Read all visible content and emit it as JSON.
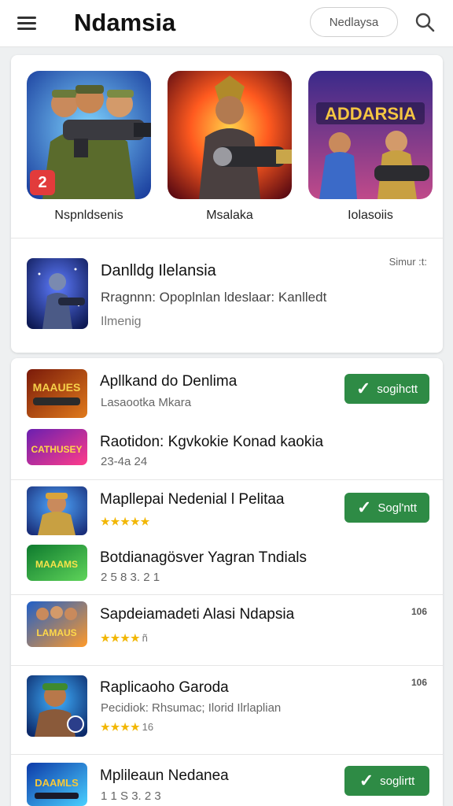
{
  "app": {
    "title": "Ndamsia",
    "search_label": "Nedlaysa"
  },
  "icons": {
    "menu": "hamburger-menu-icon",
    "search": "magnifier-icon",
    "install_check": "checkmark-icon"
  },
  "colors": {
    "accent": "#2e8b45",
    "star": "#f2b705",
    "background": "#eef0f1"
  },
  "featured": {
    "tiles": [
      {
        "label": "Nspnldsenis",
        "badge": "2"
      },
      {
        "label": "Msalaka"
      },
      {
        "label": "Iolasoiis",
        "art_text": "ADDARSIA"
      }
    ],
    "spotlight": {
      "title": "Danlldg Ilelansia",
      "subtitle": "Rragnnn: Opoplnlan ldeslaar: Kanlledt",
      "tag": "Ilmenig",
      "size": "Simur :t:"
    }
  },
  "list": [
    {
      "title": "Apllkand do Denlima",
      "subtitle": "Lasaootka Mkara",
      "art_text": "MAAUES",
      "action": {
        "check": "✓",
        "label": "sogihctt"
      }
    },
    {
      "title": "Raotidon: Kgvkokie Konad kaokia",
      "subtitle": "23-4a 24",
      "art_text": "CATHUSEY"
    },
    {
      "title": "Mapllepai Nedenial l Pelitaa",
      "rating": "★★★★★",
      "rating_value": "",
      "action": {
        "check": "✓",
        "label": "Sogl'ntt"
      }
    },
    {
      "title": "Botdianagösver Yagran Tndials",
      "subtitle": "2 5 8 3. 2 1",
      "art_text": "MAAAMS"
    },
    {
      "title": "Sapdeiamadeti Alasi Ndapsia",
      "rating": "★★★★",
      "rating_value": "ñ",
      "meta": "106",
      "art_text": "LAMAUS"
    },
    {
      "title": "Raplicaoho Garoda",
      "subtitle": "Pecidiok: Rhsumac; Ilorid Ilrlaplian",
      "rating": "★★★★",
      "rating_value": "16",
      "meta": "106"
    },
    {
      "title": "Mplileaun Nedanea",
      "subtitle": "1 1 S 3. 2 3",
      "art_text": "DAAMLS",
      "action": {
        "check": "✓",
        "label": "soglirtt"
      }
    }
  ]
}
